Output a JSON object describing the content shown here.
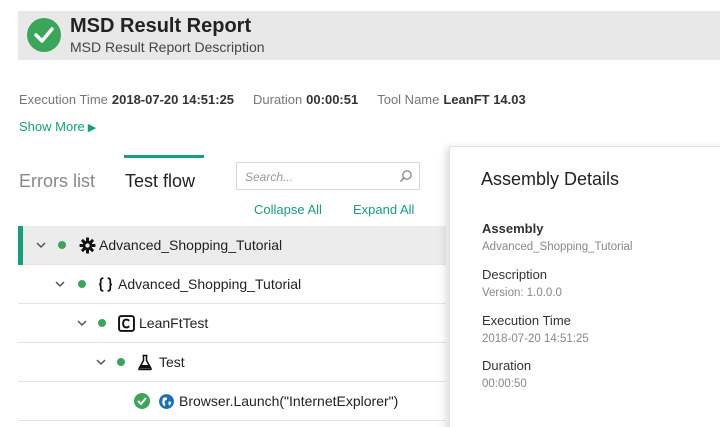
{
  "header": {
    "title": "MSD Result Report",
    "description": "MSD Result Report Description",
    "status_color": "#3aa65a"
  },
  "meta": {
    "execution_time_label": "Execution Time",
    "execution_time_value": "2018-07-20 14:51:25",
    "duration_label": "Duration",
    "duration_value": "00:00:51",
    "tool_name_label": "Tool Name",
    "tool_name_value": "LeanFT 14.03"
  },
  "show_more": {
    "label": "Show More",
    "arrow": "▶"
  },
  "tabs": [
    {
      "label": "Errors list",
      "active": false
    },
    {
      "label": "Test flow",
      "active": true
    }
  ],
  "search": {
    "placeholder": "Search...",
    "value": ""
  },
  "actions": {
    "collapse_all": "Collapse All",
    "expand_all": "Expand All"
  },
  "tree": [
    {
      "label": "Advanced_Shopping_Tutorial",
      "icon": "gear-icon",
      "status": "passed",
      "expanded": true,
      "selected": true
    },
    {
      "label": "Advanced_Shopping_Tutorial",
      "icon": "braces-icon",
      "status": "passed",
      "expanded": true,
      "selected": false
    },
    {
      "label": "LeanFtTest",
      "icon": "class-icon",
      "status": "passed",
      "expanded": true,
      "selected": false
    },
    {
      "label": "Test",
      "icon": "flask-icon",
      "status": "passed",
      "expanded": true,
      "selected": false
    },
    {
      "label_object": "Browser",
      "label_dot": ".",
      "label_method": "Launch(\"InternetExplorer\")",
      "icon": "globe-icon",
      "status": "passed",
      "expanded": false,
      "selected": false
    }
  ],
  "details": {
    "title": "Assembly Details",
    "fields": [
      {
        "key": "Assembly",
        "value": "Advanced_Shopping_Tutorial"
      },
      {
        "key": "Description",
        "value": "Version: 1.0.0.0"
      },
      {
        "key": "Execution Time",
        "value": "2018-07-20 14:51:25"
      },
      {
        "key": "Duration",
        "value": "00:00:50"
      }
    ]
  },
  "colors": {
    "accent": "#12a07f",
    "success": "#3aa65a"
  }
}
